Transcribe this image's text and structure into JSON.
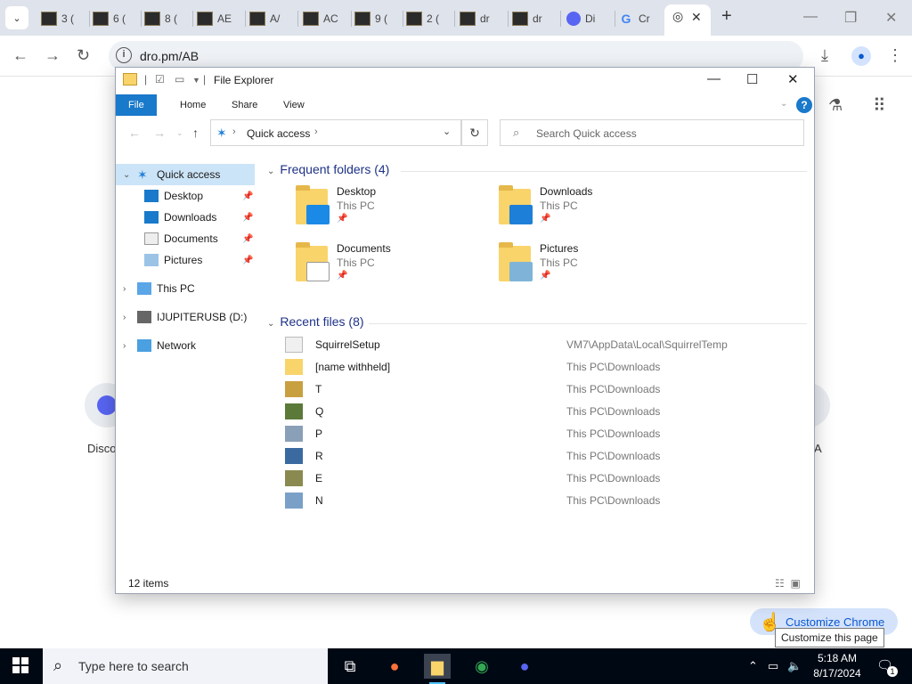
{
  "browser": {
    "tabs": [
      {
        "label": "3 (",
        "icon": "game-thumbnail-icon"
      },
      {
        "label": "6 (",
        "icon": "game-thumbnail-icon"
      },
      {
        "label": "8 (",
        "icon": "game-thumbnail-icon"
      },
      {
        "label": "AE",
        "icon": "game-thumbnail-icon"
      },
      {
        "label": "A/",
        "icon": "game-thumbnail-icon"
      },
      {
        "label": "AC",
        "icon": "game-thumbnail-icon"
      },
      {
        "label": "9 (",
        "icon": "game-thumbnail-icon"
      },
      {
        "label": "2 (",
        "icon": "game-thumbnail-icon"
      },
      {
        "label": "dr",
        "icon": "game-thumbnail-icon"
      },
      {
        "label": "dr",
        "icon": "game-thumbnail-icon"
      },
      {
        "label": "Di",
        "icon": "discord-icon"
      },
      {
        "label": "Cr",
        "icon": "google-icon"
      }
    ],
    "active_tab_icon": "chrome-icon",
    "url": "dro.pm/AB",
    "customize_label": "Customize Chrome",
    "tooltip": "Customize this page",
    "ntp_left_label": "Disco",
    "ntp_right_label": "A"
  },
  "explorer": {
    "title": "File Explorer",
    "ribbon_tabs": [
      "File",
      "Home",
      "Share",
      "View"
    ],
    "address": "Quick access",
    "search_placeholder": "Search Quick access",
    "sidebar": [
      {
        "label": "Quick access",
        "selected": true
      },
      {
        "label": "Desktop",
        "pinned": true
      },
      {
        "label": "Downloads",
        "pinned": true
      },
      {
        "label": "Documents",
        "pinned": true
      },
      {
        "label": "Pictures",
        "pinned": true
      },
      {
        "label": "This PC"
      },
      {
        "label": "IJUPITERUSB (D:)"
      },
      {
        "label": "Network"
      }
    ],
    "frequent_header": "Frequent folders (4)",
    "frequent": [
      {
        "name": "Desktop",
        "location": "This PC"
      },
      {
        "name": "Downloads",
        "location": "This PC"
      },
      {
        "name": "Documents",
        "location": "This PC"
      },
      {
        "name": "Pictures",
        "location": "This PC"
      }
    ],
    "recent_header": "Recent files (8)",
    "recent": [
      {
        "name": "SquirrelSetup",
        "path": "VM7\\AppData\\Local\\SquirrelTemp"
      },
      {
        "name": "[name withheld]",
        "path": "This PC\\Downloads"
      },
      {
        "name": "T",
        "path": "This PC\\Downloads"
      },
      {
        "name": "Q",
        "path": "This PC\\Downloads"
      },
      {
        "name": "P",
        "path": "This PC\\Downloads"
      },
      {
        "name": "R",
        "path": "This PC\\Downloads"
      },
      {
        "name": "E",
        "path": "This PC\\Downloads"
      },
      {
        "name": "N",
        "path": "This PC\\Downloads"
      }
    ],
    "status": "12 items"
  },
  "taskbar": {
    "search_placeholder": "Type here to search",
    "time": "5:18 AM",
    "date": "8/17/2024",
    "notification_count": "1"
  },
  "colors": {
    "accent": "#1979ca",
    "selection": "#cce4f7",
    "section_header": "#1e3287",
    "folder": "#f8d46b"
  }
}
